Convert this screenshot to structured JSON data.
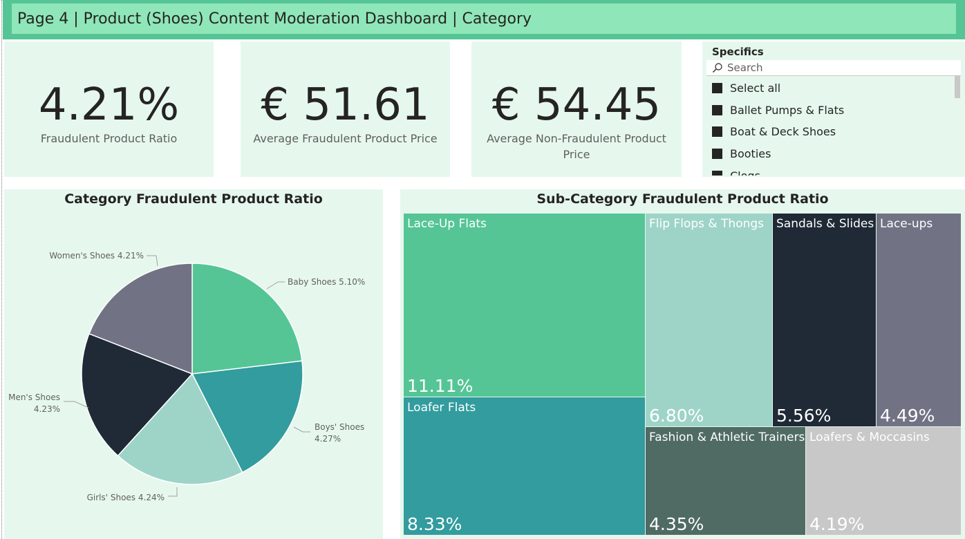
{
  "header": {
    "title": "Page 4 | Product (Shoes) Content Moderation Dashboard | Category"
  },
  "kpis": [
    {
      "value": "4.21%",
      "label": "Fraudulent Product Ratio"
    },
    {
      "value": "€ 51.61",
      "label": "Average Fraudulent Product Price"
    },
    {
      "value": "€ 54.45",
      "label_line1": "Average Non-Fraudulent Product",
      "label_line2": "Price"
    }
  ],
  "slicer": {
    "title": "Specifics",
    "search_placeholder": "Search",
    "search_icon": "search-icon",
    "items": [
      "Select all",
      "Ballet Pumps & Flats",
      "Boat & Deck Shoes",
      "Booties",
      "Clogs"
    ]
  },
  "pie": {
    "title": "Category Fraudulent Product Ratio",
    "labels": [
      {
        "text": "Baby Shoes 5.10%"
      },
      {
        "text1": "Boys' Shoes",
        "text2": "4.27%"
      },
      {
        "text": "Girls' Shoes 4.24%"
      },
      {
        "text1": "Men's Shoes",
        "text2": "4.23%"
      },
      {
        "text": "Women's Shoes 4.21%"
      }
    ]
  },
  "treemap": {
    "title": "Sub-Category Fraudulent Product Ratio"
  },
  "chart_data": [
    {
      "type": "pie",
      "title": "Category Fraudulent Product Ratio",
      "categories": [
        "Baby Shoes",
        "Boys' Shoes",
        "Girls' Shoes",
        "Men's Shoes",
        "Women's Shoes"
      ],
      "values": [
        5.1,
        4.27,
        4.24,
        4.23,
        4.21
      ],
      "colors": [
        "#55c596",
        "#329c9e",
        "#9ed4c8",
        "#1f2a36",
        "#717385"
      ]
    },
    {
      "type": "treemap",
      "title": "Sub-Category Fraudulent Product Ratio",
      "categories": [
        "Lace-Up Flats",
        "Loafer Flats",
        "Flip Flops & Thongs",
        "Sandals & Slides",
        "Lace-ups",
        "Fashion & Athletic Trainers",
        "Loafers & Moccasins"
      ],
      "values": [
        11.11,
        8.33,
        6.8,
        5.56,
        4.49,
        4.35,
        4.19
      ],
      "value_labels": [
        "11.11%",
        "8.33%",
        "6.80%",
        "5.56%",
        "4.49%",
        "4.35%",
        "4.19%"
      ],
      "colors": [
        "#55c596",
        "#329c9e",
        "#9ed4c8",
        "#1f2a36",
        "#717385",
        "#4f6b64",
        "#c8c8c8"
      ]
    }
  ]
}
